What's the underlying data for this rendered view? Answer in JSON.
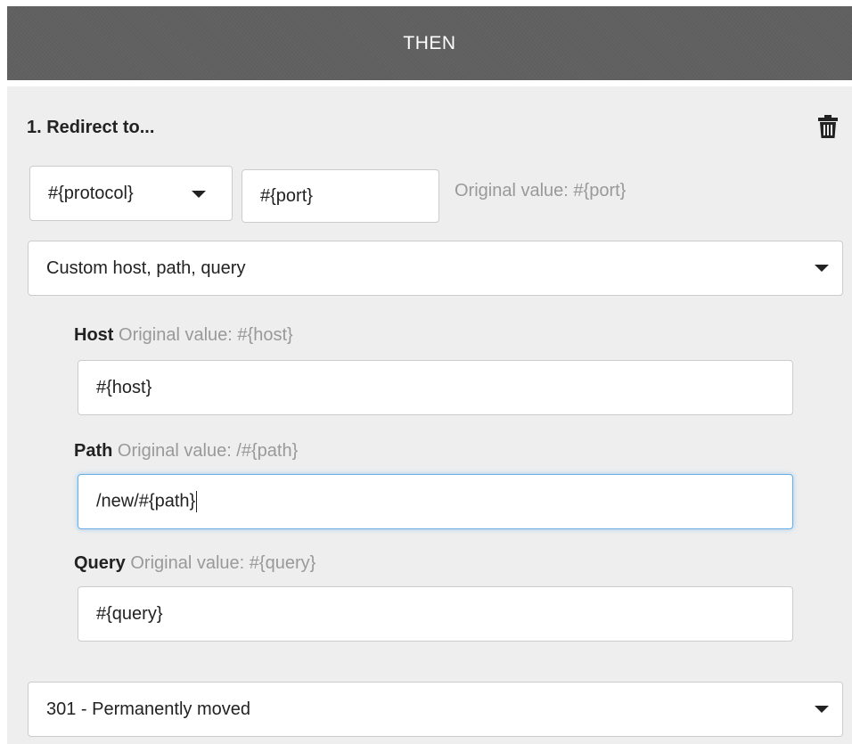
{
  "header": {
    "title": "THEN"
  },
  "action": {
    "title": "1. Redirect to...",
    "delete_icon": "trash-icon",
    "protocol_select": {
      "value": "#{protocol}"
    },
    "port_input": {
      "value": "#{port}",
      "original_hint": "Original value: #{port}"
    },
    "mode_select": {
      "value": "Custom host, path, query"
    },
    "host": {
      "label": "Host",
      "original": "Original value: #{host}",
      "value": "#{host}"
    },
    "path": {
      "label": "Path",
      "original": "Original value: /#{path}",
      "value": "/new/#{path}"
    },
    "query": {
      "label": "Query",
      "original": "Original value: #{query}",
      "value": "#{query}"
    },
    "status_select": {
      "value": "301 - Permanently moved"
    }
  },
  "colors": {
    "header_bg": "#5f5f5f",
    "panel_bg": "#eeeeee",
    "focus_border": "#66afe9",
    "hint_text": "#999999"
  }
}
